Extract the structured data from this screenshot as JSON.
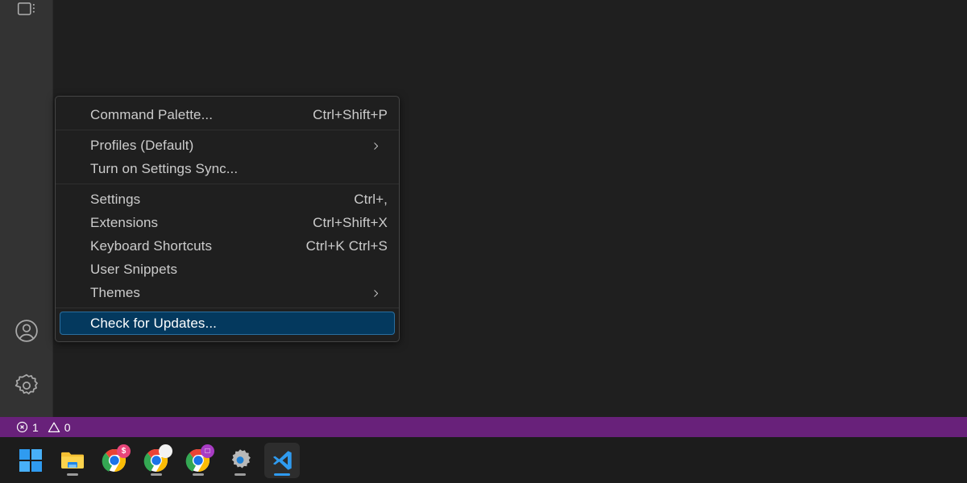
{
  "app": {
    "name": "Visual Studio Code",
    "editor_background": "#1f1f1f",
    "activity_bar_background": "#333333"
  },
  "activity_bar": {
    "items": [
      {
        "name": "panel-icon",
        "label": ""
      },
      {
        "name": "accounts-icon",
        "label": "Accounts"
      },
      {
        "name": "manage-gear-icon",
        "label": "Manage"
      }
    ]
  },
  "context_menu": {
    "name": "manage-gear-menu",
    "groups": [
      {
        "items": [
          {
            "label": "Command Palette...",
            "keybind": "Ctrl+Shift+P",
            "submenu": false,
            "selected": false
          }
        ]
      },
      {
        "items": [
          {
            "label": "Profiles (Default)",
            "keybind": "",
            "submenu": true,
            "selected": false
          },
          {
            "label": "Turn on Settings Sync...",
            "keybind": "",
            "submenu": false,
            "selected": false
          }
        ]
      },
      {
        "items": [
          {
            "label": "Settings",
            "keybind": "Ctrl+,",
            "submenu": false,
            "selected": false
          },
          {
            "label": "Extensions",
            "keybind": "Ctrl+Shift+X",
            "submenu": false,
            "selected": false
          },
          {
            "label": "Keyboard Shortcuts",
            "keybind": "Ctrl+K Ctrl+S",
            "submenu": false,
            "selected": false
          },
          {
            "label": "User Snippets",
            "keybind": "",
            "submenu": false,
            "selected": false
          },
          {
            "label": "Themes",
            "keybind": "",
            "submenu": true,
            "selected": false
          }
        ]
      },
      {
        "items": [
          {
            "label": "Check for Updates...",
            "keybind": "",
            "submenu": false,
            "selected": true
          }
        ]
      }
    ],
    "selected_background": "#04395e",
    "border_color": "#454545"
  },
  "status_bar": {
    "background": "#68217a",
    "errors_icon": "error-icon",
    "errors_count": "1",
    "warnings_icon": "warning-icon",
    "warnings_count": "0"
  },
  "taskbar": {
    "background": "#1c1c1c",
    "items": [
      {
        "name": "start-button",
        "label": "Start",
        "badge": "",
        "badge_color": "",
        "active": false,
        "running": false
      },
      {
        "name": "file-explorer-button",
        "label": "File Explorer",
        "badge": "",
        "badge_color": "",
        "active": false,
        "running": true
      },
      {
        "name": "chrome-button-1",
        "label": "Google Chrome",
        "badge": "$",
        "badge_color": "#e8457a",
        "active": false,
        "running": false
      },
      {
        "name": "chrome-button-2",
        "label": "Google Chrome",
        "badge": "",
        "badge_color": "#f2f2f2",
        "active": false,
        "running": true
      },
      {
        "name": "chrome-button-3",
        "label": "Google Chrome",
        "badge": "□",
        "badge_color": "#a83cc4",
        "active": false,
        "running": true
      },
      {
        "name": "settings-button",
        "label": "Settings",
        "badge": "",
        "badge_color": "",
        "active": false,
        "running": true
      },
      {
        "name": "vscode-button",
        "label": "Visual Studio Code",
        "badge": "",
        "badge_color": "",
        "active": true,
        "running": true
      }
    ]
  }
}
